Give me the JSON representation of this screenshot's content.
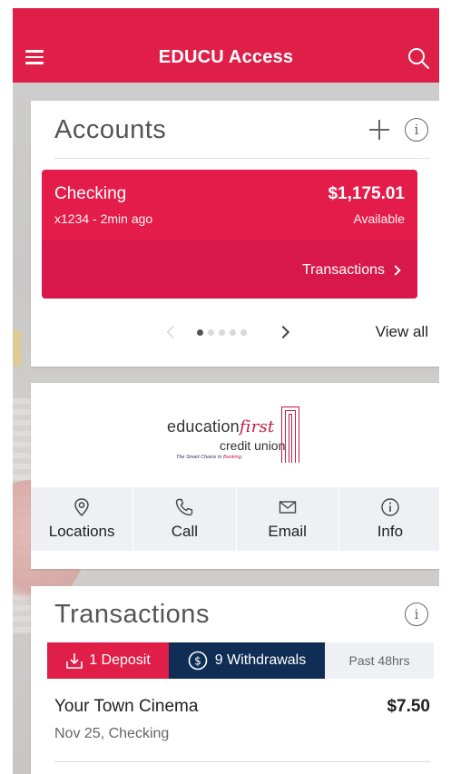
{
  "app": {
    "title": "EDUCU Access"
  },
  "accounts": {
    "title": "Accounts",
    "view_all": "View all",
    "items": [
      {
        "name": "Checking",
        "meta": "x1234 - 2min ago",
        "balance": "$1,175.01",
        "balance_label": "Available",
        "transactions_link": "Transactions"
      }
    ],
    "pager": {
      "pages": 5,
      "current": 1
    }
  },
  "bank": {
    "logo": {
      "word1": "education",
      "word2": "first",
      "line2": "credit union",
      "tagline_a": "The Smart Choice In",
      "tagline_b": "Banking."
    },
    "actions": [
      {
        "label": "Locations",
        "icon": "location-pin-icon"
      },
      {
        "label": "Call",
        "icon": "phone-icon"
      },
      {
        "label": "Email",
        "icon": "envelope-icon"
      },
      {
        "label": "Info",
        "icon": "info-icon"
      }
    ]
  },
  "transactions": {
    "title": "Transactions",
    "filters": {
      "deposits": "1 Deposit",
      "withdrawals": "9 Withdrawals",
      "period": "Past 48hrs"
    },
    "items": [
      {
        "name": "Your Town Cinema",
        "amount": "$7.50",
        "meta": "Nov 25, Checking"
      }
    ]
  },
  "colors": {
    "brand_red": "#df1f48",
    "navy": "#0f2d55"
  }
}
